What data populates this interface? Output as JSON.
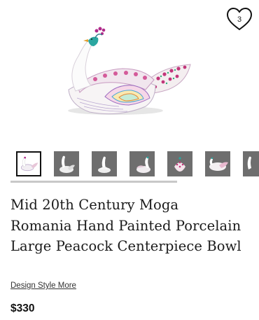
{
  "favorite": {
    "icon": "heart-icon",
    "count": "3"
  },
  "gallery": {
    "main_image": "peacock-bowl-image",
    "thumbnails": [
      {
        "label": "view-1",
        "selected": true
      },
      {
        "label": "view-2",
        "selected": false
      },
      {
        "label": "view-3",
        "selected": false
      },
      {
        "label": "view-4",
        "selected": false
      },
      {
        "label": "view-5",
        "selected": false
      },
      {
        "label": "view-6",
        "selected": false
      },
      {
        "label": "view-7",
        "selected": false
      }
    ]
  },
  "product": {
    "title": "Mid 20th Century Moga Romania Hand Painted Porcelain Large Peacock Centerpiece Bowl",
    "seller": "Design Style More",
    "price": "$330"
  },
  "colors": {
    "accent_dark": "#111111",
    "thumb_bg": "#6e6e6e",
    "scrollbar": "#c8c8c8"
  }
}
